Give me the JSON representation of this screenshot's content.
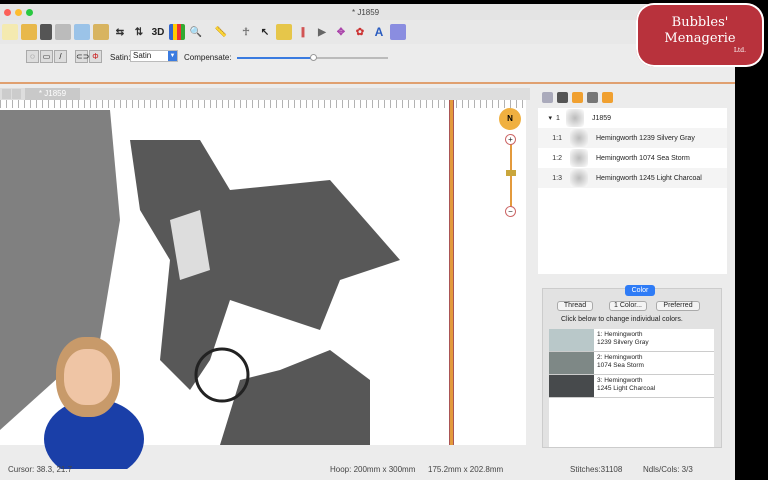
{
  "window": {
    "title": "* J1859"
  },
  "logo": {
    "line1": "Bubbles'",
    "line2": "Menagerie",
    "line3": "Ltd."
  },
  "toolbar": {
    "icons": [
      "new-icon",
      "open-icon",
      "save-icon",
      "print-icon",
      "copy-icon",
      "paste-icon",
      "mirror-horizontal-icon",
      "mirror-vertical-icon",
      "3d-view-icon",
      "chart-icon",
      "zoom-icon",
      "ruler-icon",
      "figure-icon",
      "select-icon",
      "frame-icon",
      "thread-icon",
      "play-icon",
      "transform-icon",
      "color-icon",
      "text-icon",
      "cube-icon"
    ],
    "label_3d": "3D",
    "label_text": "A"
  },
  "options": {
    "satin_label": "Satin:",
    "satin_value": "Satin",
    "compensate_label": "Compensate:",
    "compensate_value": 0.5
  },
  "document_tab": "* J1859",
  "tree": {
    "root_number": "1",
    "root_name": "J1859",
    "items": [
      {
        "number": "1:1",
        "name": "Hemingworth 1239 Silvery Gray"
      },
      {
        "number": "1:2",
        "name": "Hemingworth 1074 Sea Storm"
      },
      {
        "number": "1:3",
        "name": "Hemingworth 1245 Light Charcoal"
      }
    ]
  },
  "color_panel": {
    "tab": "Color",
    "thread_button": "Thread",
    "one_color_button": "1 Color...",
    "preferred_button": "Preferred",
    "hint": "Click below to change individual colors.",
    "swatches": [
      {
        "line1": "1: Hemingworth",
        "line2": "1239 Silvery Gray",
        "color": "#b9c8c9"
      },
      {
        "line1": "2: Hemingworth",
        "line2": "1074 Sea Storm",
        "color": "#7e8886"
      },
      {
        "line1": "3: Hemingworth",
        "line2": "1245 Light Charcoal",
        "color": "#474a4c"
      }
    ]
  },
  "status": {
    "cursor": "Cursor: 38.3, 21.7",
    "hoop": "Hoop: 200mm x 300mm",
    "size": "175.2mm x 202.8mm",
    "stitches": "Stitches:31108",
    "ndls": "Ndls/Cols: 3/3"
  }
}
